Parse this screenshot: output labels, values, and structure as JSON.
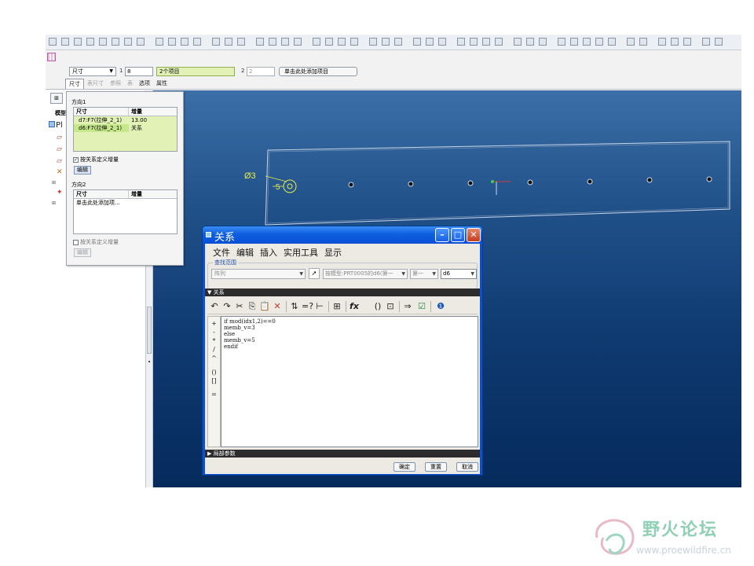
{
  "dashboard": {
    "dimension_type": "尺寸",
    "dir1_number": "1",
    "dir1_count": "8",
    "dir1_items": "2个项目",
    "dir2_number": "2",
    "dir2_count": "2",
    "add_item_button": "单击此处添加项目",
    "tabs": [
      "尺寸",
      "表尺寸",
      "参照",
      "表",
      "选项",
      "属性"
    ]
  },
  "nav": {
    "model_label": "模型",
    "root_label": "Pl"
  },
  "pattern_panel": {
    "direction1_label": "方向1",
    "direction2_label": "方向2",
    "col_dimension": "尺寸",
    "col_increment": "增量",
    "dir1_rows": [
      {
        "dim": "d7:F7(拉伸_2_1)",
        "inc": "13.00"
      },
      {
        "dim": "d6:F7(拉伸_2_1)",
        "inc": "关系"
      }
    ],
    "dir2_placeholder": "单击此处添加项...",
    "define_by_relation_1": "按关系定义增量",
    "define_by_relation_2": "按关系定义增量",
    "edit_button_1": "编辑",
    "edit_button_2": "编辑"
  },
  "graphics": {
    "diameter_label": "Ø3",
    "dim_label": "5"
  },
  "relations": {
    "title": "关系",
    "menus": [
      "文件",
      "编辑",
      "插入",
      "实用工具",
      "显示"
    ],
    "find_scope_label": "查找范围",
    "scope_value": "阵列",
    "feature_value": "按模型:PRT0005的d6(第一",
    "first_value": "第一",
    "param_value": "d6",
    "section_label": "关系",
    "code_lines": [
      "if  mod(idx1,2)==0",
      "memb_v=3",
      "else",
      "memb_v=5",
      "endif"
    ],
    "operators": [
      "+",
      "-",
      "*",
      "/",
      "^",
      "()",
      "[]",
      "="
    ],
    "local_params_label": "局部参数",
    "ok_button": "确定",
    "reset_button": "重置",
    "cancel_button": "取消"
  },
  "watermark": {
    "title": "野火论坛",
    "url": "www.proewildfire.cn"
  }
}
